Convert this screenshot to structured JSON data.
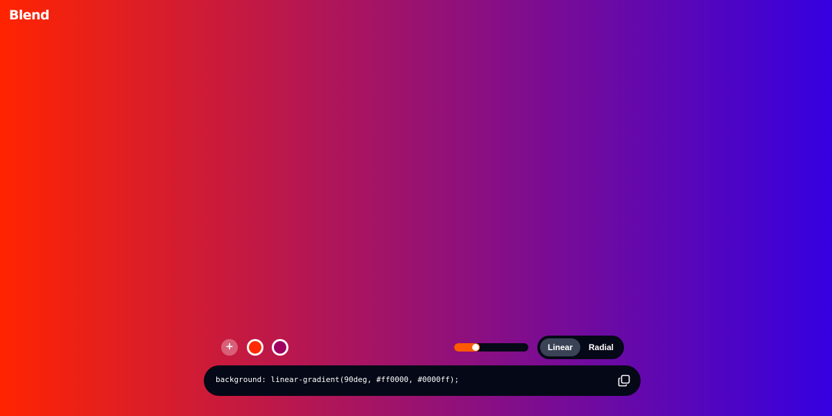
{
  "app": {
    "logo": "Blend"
  },
  "gradient": {
    "type": "linear",
    "angle_deg": 90,
    "colors": [
      "#ff0000",
      "#0000ff"
    ],
    "rendered_start": "#ff2400",
    "rendered_end": "#3500e0"
  },
  "controls": {
    "add_stop_label": "+",
    "stops": [
      {
        "color": "#ff2a00"
      },
      {
        "color": "#a00060"
      }
    ],
    "angle_slider": {
      "value": 90,
      "max": 360,
      "fill_color": "#ff5a00"
    },
    "type_toggle": {
      "linear_label": "Linear",
      "radial_label": "Radial",
      "selected": "Linear"
    }
  },
  "code": {
    "css": "background: linear-gradient(90deg, #ff0000, #0000ff);",
    "copy_icon": "copy-icon"
  }
}
